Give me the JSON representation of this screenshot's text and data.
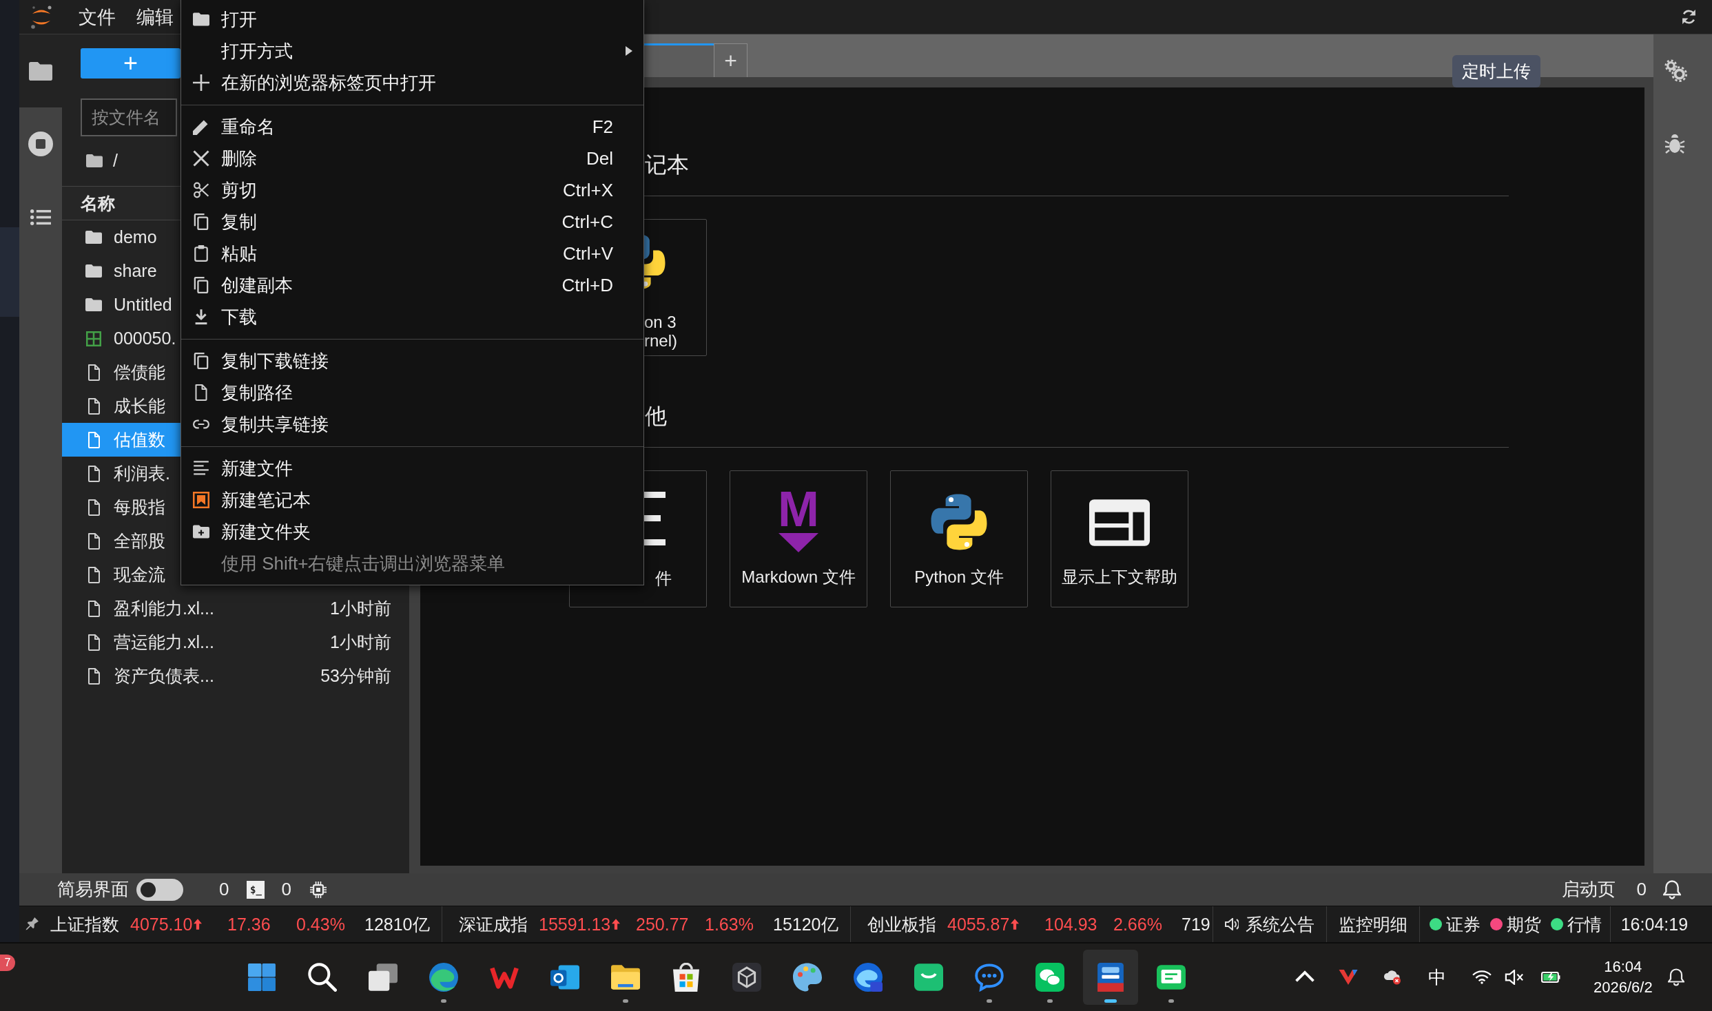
{
  "menubar": {
    "items": [
      {
        "label": "文件"
      },
      {
        "label": "编辑"
      }
    ]
  },
  "activity_bar": {
    "tabs": [
      {
        "kind": "files",
        "selected": true
      },
      {
        "kind": "running",
        "selected": false
      },
      {
        "kind": "toc",
        "selected": false
      }
    ]
  },
  "file_browser": {
    "new_button": "+",
    "filter": {
      "placeholder": "按文件名"
    },
    "breadcrumb": "/",
    "columns": [
      "名称"
    ],
    "rows": [
      {
        "name": "demo",
        "kind": "folder",
        "selected": false
      },
      {
        "name": "share",
        "kind": "folder",
        "selected": false
      },
      {
        "name": "Untitled",
        "kind": "folder",
        "selected": false
      },
      {
        "name": "000050.",
        "kind": "spreadsheet",
        "selected": false
      },
      {
        "name": "偿债能",
        "kind": "file",
        "selected": false
      },
      {
        "name": "成长能",
        "kind": "file",
        "selected": false
      },
      {
        "name": "估值数",
        "kind": "file",
        "selected": true
      },
      {
        "name": "利润表.",
        "kind": "file",
        "selected": false
      },
      {
        "name": "每股指",
        "kind": "file",
        "selected": false
      },
      {
        "name": "全部股",
        "kind": "file",
        "selected": false
      },
      {
        "name": "现金流",
        "kind": "file",
        "selected": false
      },
      {
        "name": "盈利能力.xl...",
        "kind": "file",
        "selected": false,
        "modified": "1小时前"
      },
      {
        "name": "营运能力.xl...",
        "kind": "file",
        "selected": false,
        "modified": "1小时前"
      },
      {
        "name": "资产负债表...",
        "kind": "file",
        "selected": false,
        "modified": "53分钟前"
      }
    ]
  },
  "context_menu": {
    "items": [
      {
        "kind": "item",
        "label": "打开"
      },
      {
        "kind": "item",
        "label": "打开方式",
        "submenu": true
      },
      {
        "kind": "item",
        "label": "在新的浏览器标签页中打开"
      },
      {
        "kind": "separator"
      },
      {
        "kind": "item",
        "label": "重命名",
        "shortcut": "F2"
      },
      {
        "kind": "item",
        "label": "删除",
        "shortcut": "Del"
      },
      {
        "kind": "item",
        "label": "剪切",
        "shortcut": "Ctrl+X"
      },
      {
        "kind": "item",
        "label": "复制",
        "shortcut": "Ctrl+C"
      },
      {
        "kind": "item",
        "label": "粘贴",
        "shortcut": "Ctrl+V"
      },
      {
        "kind": "item",
        "label": "创建副本",
        "shortcut": "Ctrl+D"
      },
      {
        "kind": "item",
        "label": "下载"
      },
      {
        "kind": "separator"
      },
      {
        "kind": "item",
        "label": "复制下载链接"
      },
      {
        "kind": "item",
        "label": "复制路径"
      },
      {
        "kind": "item",
        "label": "复制共享链接"
      },
      {
        "kind": "separator"
      },
      {
        "kind": "item",
        "label": "新建文件"
      },
      {
        "kind": "item",
        "label": "新建笔记本"
      },
      {
        "kind": "item",
        "label": "新建文件夹"
      },
      {
        "kind": "hint",
        "label": "使用 Shift+右键点击调出浏览器菜单"
      }
    ]
  },
  "main_area": {
    "tabs": [
      {
        "selected": true
      }
    ],
    "add_tab": "+",
    "tooltip": "定时上传",
    "launcher": {
      "sections": [
        {
          "title": "记本",
          "cards": [
            {
              "kind": "python",
              "partial": true,
              "label_lines": [
                "on 3",
                "rnel)"
              ]
            }
          ]
        },
        {
          "title": "他",
          "cards": [
            {
              "kind": "text",
              "partial": true,
              "label": "件"
            },
            {
              "kind": "markdown",
              "partial": false,
              "icon_letter": "M",
              "label": "Markdown 文件"
            },
            {
              "kind": "python",
              "partial": false,
              "label": "Python 文件"
            },
            {
              "kind": "help",
              "partial": false,
              "label": "显示上下文帮助"
            }
          ]
        }
      ]
    }
  },
  "status_bar": {
    "simple_mode": {
      "label": "简易界面",
      "on": false
    },
    "running": [
      {
        "kind": "terminal",
        "count": "0",
        "badge": "$_"
      },
      {
        "kind": "kernel",
        "count": "0"
      }
    ],
    "launcher_label": "启动页",
    "notification_count": "0"
  },
  "market_ticker": {
    "indices": [
      {
        "name": "上证指数",
        "price": "4075.10",
        "rising": true,
        "change": "17.36",
        "percent": "0.43%",
        "volume": "12810亿"
      },
      {
        "name": "深证成指",
        "price": "15591.13",
        "rising": true,
        "change": "250.77",
        "percent": "1.63%",
        "volume": "15120亿"
      },
      {
        "name": "创业板指",
        "price": "4055.87",
        "rising": true,
        "change": "104.93",
        "percent": "2.66%",
        "volume": "719"
      }
    ],
    "announcement": "系统公告",
    "monitor": "监控明细",
    "connections": [
      {
        "label": "证券",
        "color": "#3ddc84"
      },
      {
        "label": "期货",
        "color": "#f5487f"
      },
      {
        "label": "行情",
        "color": "#3ddc84"
      }
    ],
    "time": "16:04:19"
  },
  "taskbar": {
    "badge": "7",
    "apps": [
      {
        "running": false,
        "selected": false
      },
      {
        "running": false,
        "selected": false
      },
      {
        "running": false,
        "selected": false
      },
      {
        "running": true,
        "selected": false
      },
      {
        "running": false,
        "selected": false
      },
      {
        "running": false,
        "selected": false
      },
      {
        "running": true,
        "selected": false
      },
      {
        "running": false,
        "selected": false
      },
      {
        "running": false,
        "selected": false
      },
      {
        "running": false,
        "selected": false
      },
      {
        "running": false,
        "selected": false
      },
      {
        "running": false,
        "selected": false
      },
      {
        "running": true,
        "selected": false
      },
      {
        "running": true,
        "selected": false
      },
      {
        "running": true,
        "selected": true
      },
      {
        "running": true,
        "selected": false
      }
    ],
    "input_method": "中",
    "clock": {
      "time": "16:04",
      "date": "2026/6/2"
    }
  }
}
